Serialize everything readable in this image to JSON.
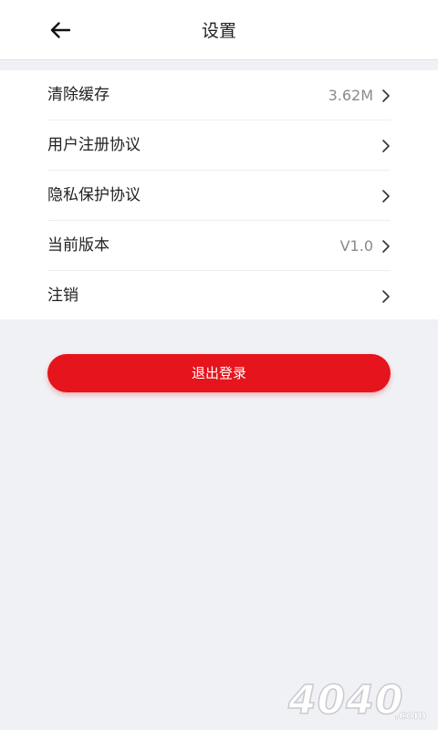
{
  "header": {
    "title": "设置",
    "back_icon": "arrow-left-icon"
  },
  "settings": {
    "items": [
      {
        "label": "清除缓存",
        "value": "3.62M"
      },
      {
        "label": "用户注册协议",
        "value": ""
      },
      {
        "label": "隐私保护协议",
        "value": ""
      },
      {
        "label": "当前版本",
        "value": "V1.0"
      },
      {
        "label": "注销",
        "value": ""
      }
    ],
    "chevron_icon": "chevron-right-icon"
  },
  "logout": {
    "label": "退出登录"
  },
  "colors": {
    "accent": "#e6141c",
    "page_background": "#f0f1f5",
    "card_background": "#ffffff",
    "primary_text": "#222222",
    "secondary_text": "#8a8a8e"
  },
  "watermark": {
    "text": "4040",
    "suffix": ".com"
  }
}
